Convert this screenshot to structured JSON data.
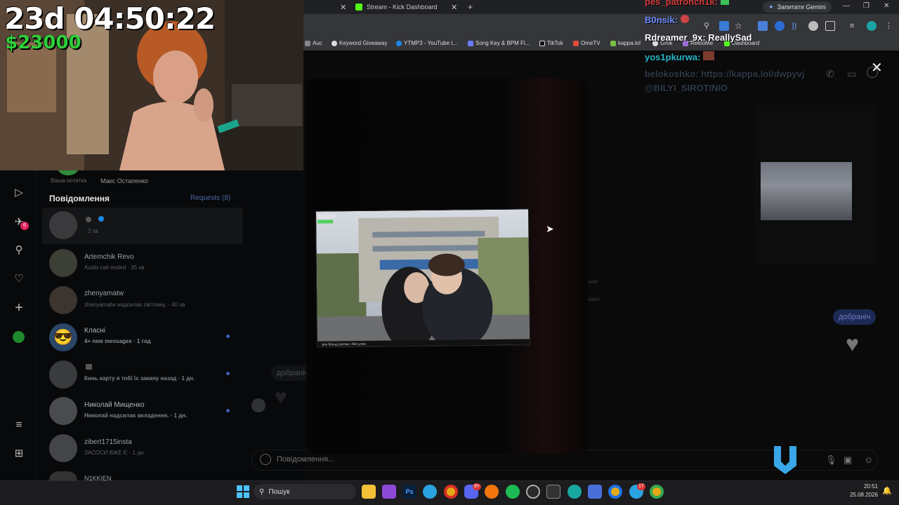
{
  "stream_overlay": {
    "timer": "23d 04:50:22",
    "money": "$23000"
  },
  "browser": {
    "tabs": [
      {
        "label": "Stream - Kick Dashboard"
      }
    ],
    "gemini_button": "Запитати Gemini",
    "bookmarks": [
      {
        "label": "Auc"
      },
      {
        "label": "Keyword Giveaway"
      },
      {
        "label": "YTMP3 - YouTube t..."
      },
      {
        "label": "Song Key & BPM Fi..."
      },
      {
        "label": "TikTok"
      },
      {
        "label": "OmeTV"
      },
      {
        "label": "kappa.lol"
      },
      {
        "label": "Grok"
      },
      {
        "label": "RektoMe"
      },
      {
        "label": "Dashboard"
      }
    ]
  },
  "stream_chat": [
    {
      "user": "pes_patronch1k:",
      "text": "",
      "color": "#d23c3c"
    },
    {
      "user": "B0nsik:",
      "text": "",
      "color": "#6e8cff"
    },
    {
      "user": "Rdreamer_9x:",
      "text": "ReallySad",
      "color": "#ffffff"
    },
    {
      "user": "yos1pkurwa:",
      "text": "",
      "color": "#2ab7c8"
    },
    {
      "user": "belokoshko:",
      "text": "https://kappa.lol/dwpyvj",
      "color": "#2f3a46"
    },
    {
      "user": "",
      "text": "@BILYI_SIROTINIO",
      "color": "#2f3a46"
    }
  ],
  "instagram": {
    "notes": [
      {
        "label": "Ваша нотатка"
      },
      {
        "label": "Макс Остапенко"
      }
    ],
    "title": "Повідомлення",
    "requests": "Requests (8)",
    "rail_badge": "6",
    "conversations": [
      {
        "name": "",
        "sub": "· 2 хв",
        "selected": true,
        "unread": false
      },
      {
        "name": "Artemchik Revo",
        "sub": "Audio call ended · 35 хв",
        "selected": false,
        "unread": false
      },
      {
        "name": "zhenyamatw",
        "sub": "zhenyamatw надсилає світлину. · 40 хв",
        "selected": false,
        "unread": false
      },
      {
        "name": "Класні",
        "sub": "4+ new messages · 1 год",
        "selected": false,
        "unread": true
      },
      {
        "name": "",
        "sub": "Кинь карту я тобі їх закину назад · 1 дн.",
        "selected": false,
        "unread": true
      },
      {
        "name": "Николай Мищенко",
        "sub": "Николай надсилає вкладення. · 1 дн.",
        "selected": false,
        "unread": true
      },
      {
        "name": "zibert1715insta",
        "sub": "ЗАСОСИ ВЖЕ Є · 1 дн.",
        "selected": false,
        "unread": false
      },
      {
        "name": "N1KKIEN",
        "sub": "",
        "selected": false,
        "unread": false
      }
    ],
    "chat": {
      "bubble_right": "добраніч",
      "bubble_left": "добраніч",
      "faint_1": "нок",
      "faint_2": "шен",
      "composer_placeholder": "Повідомлення..."
    }
  },
  "video_overlay_text": "зра більші ритми і без утри",
  "taskbar": {
    "search": "Пошук",
    "time": "20:51",
    "date": "25.08.2026",
    "discord_badge": "9+",
    "badge2": "17"
  }
}
